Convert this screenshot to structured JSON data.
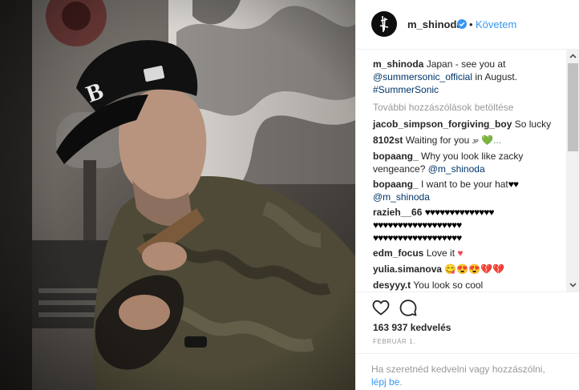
{
  "post": {
    "username": "m_shinoda",
    "follow_label": "Követem",
    "dot": "•",
    "caption": {
      "user": "m_shinoda",
      "text_a": "Japan - see you at",
      "mention": "@summersonic_official",
      "text_b": "in August.",
      "hashtag": "#SummerSonic"
    },
    "load_more": "További hozzászólások betöltése",
    "comments": [
      {
        "user": "jacob_simpson_forgiving_boy",
        "text": "So lucky"
      },
      {
        "user": "8102st",
        "text": "Waiting for you",
        "extra": "JP",
        "emoji": "💚..."
      },
      {
        "user": "bopaang_",
        "text_a": "Why you look like zacky",
        "text_b": "vengeance?",
        "mention": "@m_shinoda"
      },
      {
        "user": "bopaang_",
        "text_a": "I want to be your hat",
        "hearts": "♥♥",
        "mention": "@m_shinoda"
      },
      {
        "user": "razieh__66",
        "hearts_1": "♥♥♥♥♥♥♥♥♥♥♥♥♥♥",
        "hearts_2": "♥♥♥♥♥♥♥♥♥♥♥♥♥♥♥♥♥♥",
        "hearts_3": "♥♥♥♥♥♥♥♥♥♥♥♥♥♥♥♥♥♥"
      },
      {
        "user": "edm_focus",
        "text": "Love it",
        "heart": "♥"
      },
      {
        "user": "yulia.simanova",
        "emojis": "😋😍😍💔💔"
      },
      {
        "user": "desyyy.t",
        "text": "You look so cool"
      }
    ],
    "likes": "163 937 kedvelés",
    "date": "FEBRUÁR 1.",
    "login_a": "Ha szeretnéd kedvelni vagy hozzászólni,",
    "login_link": "lépj be",
    "login_b": "."
  },
  "colors": {
    "link": "#003569",
    "accent": "#3897f0",
    "muted": "#999999",
    "heart_red": "#ed4956"
  },
  "icons": [
    "heart-icon",
    "comment-icon",
    "verified-badge-icon",
    "scroll-up-icon",
    "scroll-down-icon"
  ]
}
